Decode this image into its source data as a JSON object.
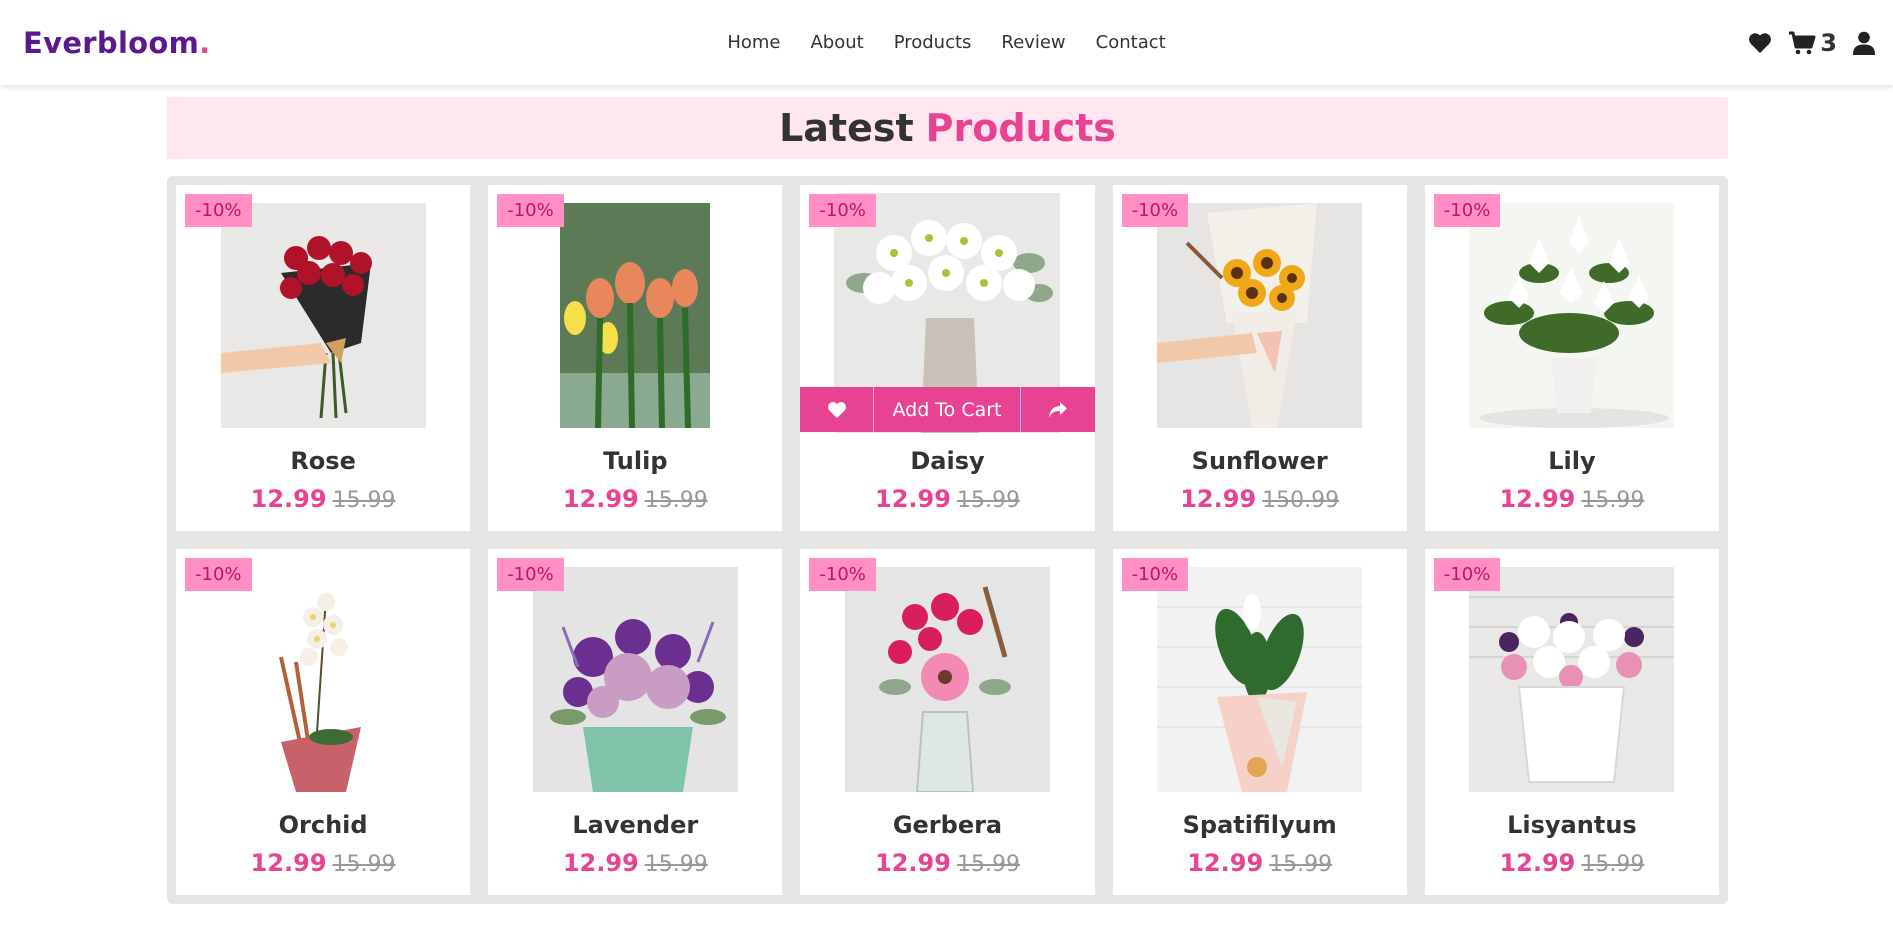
{
  "brand": {
    "name": "Everbloom",
    "dot": "."
  },
  "nav": [
    "Home",
    "About",
    "Products",
    "Review",
    "Contact"
  ],
  "header_icons": {
    "cart_count": "3"
  },
  "section": {
    "title_a": "Latest",
    "title_b": "Products"
  },
  "actions": {
    "add_to_cart": "Add To Cart"
  },
  "products": [
    {
      "name": "Rose",
      "price": "12.99",
      "old_price": "15.99",
      "discount": "-10%"
    },
    {
      "name": "Tulip",
      "price": "12.99",
      "old_price": "15.99",
      "discount": "-10%"
    },
    {
      "name": "Daisy",
      "price": "12.99",
      "old_price": "15.99",
      "discount": "-10%"
    },
    {
      "name": "Sunflower",
      "price": "12.99",
      "old_price": "150.99",
      "discount": "-10%"
    },
    {
      "name": "Lily",
      "price": "12.99",
      "old_price": "15.99",
      "discount": "-10%"
    },
    {
      "name": "Orchid",
      "price": "12.99",
      "old_price": "15.99",
      "discount": "-10%"
    },
    {
      "name": "Lavender",
      "price": "12.99",
      "old_price": "15.99",
      "discount": "-10%"
    },
    {
      "name": "Gerbera",
      "price": "12.99",
      "old_price": "15.99",
      "discount": "-10%"
    },
    {
      "name": "Spatifilyum",
      "price": "12.99",
      "old_price": "15.99",
      "discount": "-10%"
    },
    {
      "name": "Lisyantus",
      "price": "12.99",
      "old_price": "15.99",
      "discount": "-10%"
    }
  ],
  "colors": {
    "brand": "#5a1990",
    "accent": "#e84393",
    "badge": "#ff8fc5",
    "heading_bg": "#ffe6f1"
  }
}
